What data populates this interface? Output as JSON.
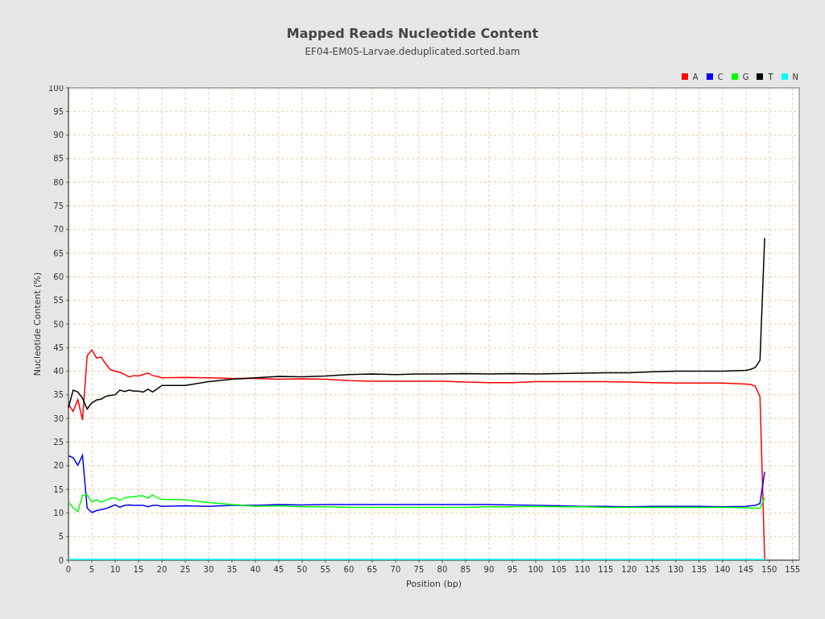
{
  "chart_data": {
    "type": "line",
    "title": "Mapped Reads Nucleotide Content",
    "xlabel": "Position (bp)",
    "ylabel": "Nucleotide Content (%)",
    "x": [
      0,
      1,
      2,
      3,
      4,
      5,
      6,
      7,
      8,
      9,
      10,
      11,
      12,
      13,
      14,
      15,
      16,
      17,
      18,
      19,
      20,
      25,
      30,
      35,
      40,
      45,
      50,
      55,
      60,
      65,
      70,
      75,
      80,
      85,
      90,
      95,
      100,
      105,
      110,
      115,
      120,
      125,
      130,
      135,
      140,
      145,
      146,
      147,
      148,
      149
    ],
    "series": [
      {
        "name": "A",
        "color": "#ff0000",
        "values": [
          33,
          31.5,
          34,
          29.7,
          43.3,
          44.5,
          42.8,
          43,
          41.5,
          40.3,
          40,
          39.8,
          39.3,
          38.8,
          39.1,
          39,
          39.3,
          39.6,
          39.1,
          38.9,
          38.6,
          38.7,
          38.6,
          38.5,
          38.5,
          38.3,
          38.4,
          38.3,
          38,
          37.9,
          37.9,
          37.9,
          37.9,
          37.7,
          37.6,
          37.6,
          37.8,
          37.8,
          37.8,
          37.8,
          37.7,
          37.6,
          37.5,
          37.5,
          37.5,
          37.3,
          37.2,
          36.8,
          34.6,
          0
        ]
      },
      {
        "name": "C",
        "color": "#0000ff",
        "values": [
          22.1,
          21.7,
          20.1,
          22.2,
          11,
          10.1,
          10.5,
          10.7,
          10.9,
          11.3,
          11.7,
          11.2,
          11.6,
          11.7,
          11.6,
          11.6,
          11.6,
          11.3,
          11.6,
          11.6,
          11.4,
          11.5,
          11.4,
          11.6,
          11.6,
          11.8,
          11.7,
          11.8,
          11.8,
          11.8,
          11.8,
          11.8,
          11.8,
          11.8,
          11.8,
          11.7,
          11.6,
          11.5,
          11.4,
          11.4,
          11.3,
          11.4,
          11.4,
          11.4,
          11.3,
          11.4,
          11.5,
          11.6,
          12,
          18.7
        ]
      },
      {
        "name": "G",
        "color": "#00ff00",
        "values": [
          12.3,
          11.1,
          10.3,
          13.7,
          13.8,
          12.3,
          12.8,
          12.3,
          12.7,
          13.1,
          13.2,
          12.7,
          13.2,
          13.4,
          13.4,
          13.6,
          13.6,
          13.1,
          13.8,
          13.2,
          12.9,
          12.8,
          12.2,
          11.8,
          11.4,
          11.5,
          11.3,
          11.3,
          11.2,
          11.2,
          11.2,
          11.2,
          11.2,
          11.2,
          11.3,
          11.3,
          11.4,
          11.3,
          11.3,
          11.2,
          11.2,
          11.2,
          11.2,
          11.2,
          11.2,
          11.1,
          11,
          11,
          11,
          13.2
        ]
      },
      {
        "name": "T",
        "color": "#000000",
        "values": [
          32.3,
          36,
          35.6,
          34.3,
          32,
          33.3,
          33.9,
          34.1,
          34.7,
          34.9,
          35,
          36,
          35.7,
          36,
          35.8,
          35.8,
          35.6,
          36.2,
          35.6,
          36.3,
          37,
          37,
          37.8,
          38.3,
          38.6,
          38.9,
          38.8,
          39,
          39.3,
          39.4,
          39.3,
          39.4,
          39.4,
          39.5,
          39.4,
          39.5,
          39.4,
          39.5,
          39.6,
          39.7,
          39.7,
          39.9,
          40,
          40,
          40,
          40.2,
          40.4,
          40.8,
          42.3,
          68.2
        ]
      },
      {
        "name": "N",
        "color": "#00ffff",
        "values": [
          0,
          0,
          0,
          0,
          0,
          0,
          0,
          0,
          0,
          0,
          0,
          0,
          0,
          0,
          0,
          0,
          0,
          0,
          0,
          0,
          0,
          0,
          0,
          0,
          0,
          0,
          0,
          0,
          0,
          0,
          0,
          0,
          0,
          0,
          0,
          0,
          0,
          0,
          0,
          0,
          0,
          0,
          0,
          0,
          0,
          0,
          0,
          0,
          0,
          0
        ]
      }
    ],
    "xlim": [
      0,
      156.4
    ],
    "grid": true,
    "ylim": [
      0,
      100
    ],
    "xticks": [
      0,
      5,
      10,
      15,
      20,
      25,
      30,
      35,
      40,
      45,
      50,
      55,
      60,
      65,
      70,
      75,
      80,
      85,
      90,
      95,
      100,
      105,
      110,
      115,
      120,
      125,
      130,
      135,
      140,
      145,
      150,
      155
    ],
    "yticks": [
      0,
      5,
      10,
      15,
      20,
      25,
      30,
      35,
      40,
      45,
      50,
      55,
      60,
      65,
      70,
      75,
      80,
      85,
      90,
      95,
      100
    ]
  },
  "subtitle": "EF04-EM05-Larvae.deduplicated.sorted.bam"
}
